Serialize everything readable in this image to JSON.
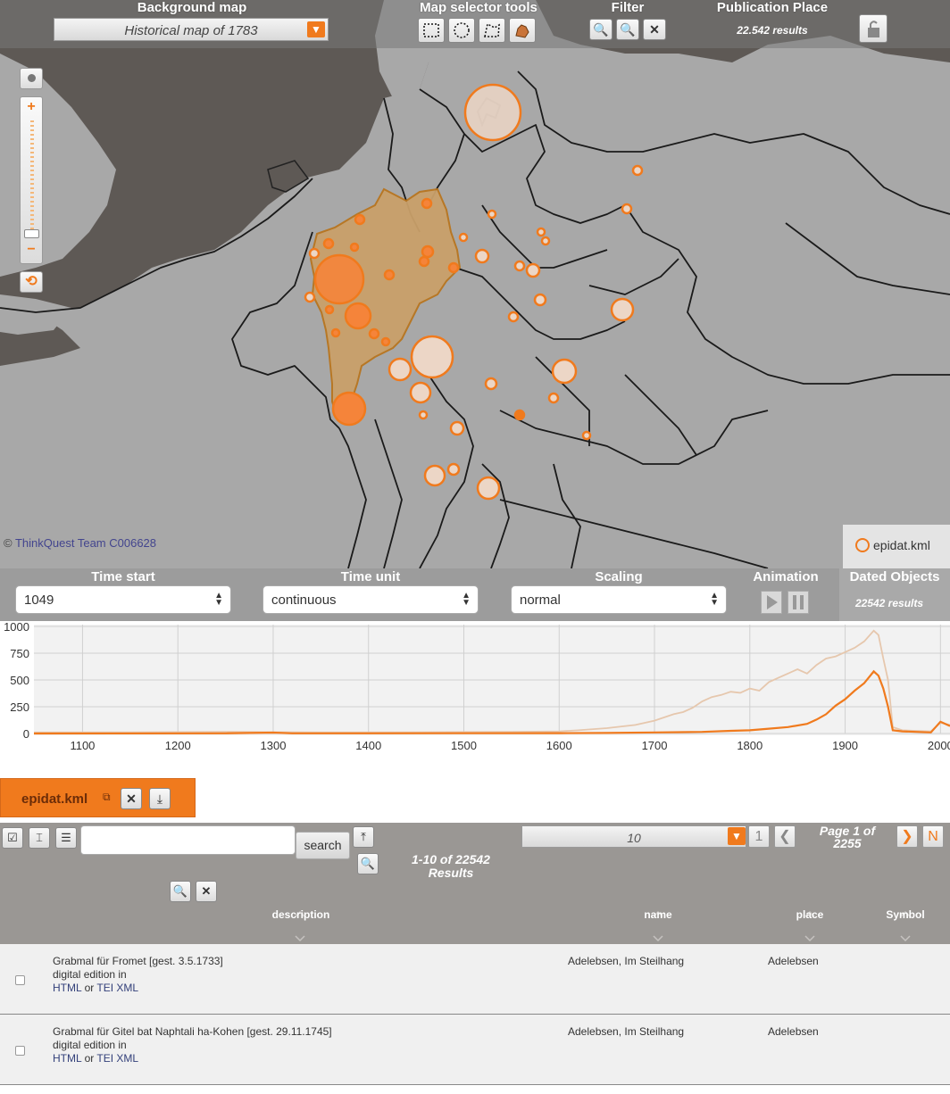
{
  "toolbar": {
    "background_map_title": "Background map",
    "background_map_value": "Historical map of 1783",
    "selector_tools_title": "Map selector tools",
    "filter_title": "Filter",
    "publication_place_title": "Publication Place",
    "publication_place_results": "22.542 results"
  },
  "map": {
    "copyright_symbol": "©",
    "copyright_text": "ThinkQuest Team C006628",
    "legend_dataset": "epidat.kml",
    "zoom_in": "+",
    "zoom_out": "−",
    "zoom_level_fraction": 0.18
  },
  "time_controls": {
    "time_start_label": "Time start",
    "time_start_value": "1049",
    "time_unit_label": "Time unit",
    "time_unit_value": "continuous",
    "scaling_label": "Scaling",
    "scaling_value": "normal",
    "animation_label": "Animation",
    "dated_objects_label": "Dated Objects",
    "dated_objects_results": "22542 results"
  },
  "chart_data": {
    "type": "line",
    "x_ticks": [
      "1100",
      "1200",
      "1300",
      "1400",
      "1500",
      "1600",
      "1700",
      "1800",
      "1900",
      "2000"
    ],
    "y_ticks": [
      "0",
      "250",
      "500",
      "750",
      "1000"
    ],
    "xlim": [
      1049,
      2010
    ],
    "ylim": [
      0,
      1000
    ],
    "grid": true,
    "series": [
      {
        "color": "#e6c7ad",
        "x": [
          1049,
          1150,
          1250,
          1350,
          1450,
          1550,
          1600,
          1620,
          1650,
          1680,
          1700,
          1710,
          1720,
          1730,
          1740,
          1750,
          1760,
          1770,
          1780,
          1790,
          1800,
          1810,
          1820,
          1830,
          1840,
          1850,
          1860,
          1870,
          1880,
          1890,
          1900,
          1910,
          1920,
          1930,
          1935,
          1940,
          1945,
          1950,
          1960,
          1990,
          2000,
          2010
        ],
        "y": [
          10,
          12,
          15,
          10,
          12,
          15,
          20,
          30,
          50,
          80,
          120,
          150,
          180,
          200,
          240,
          300,
          340,
          360,
          390,
          380,
          420,
          400,
          480,
          520,
          560,
          600,
          560,
          640,
          700,
          720,
          760,
          800,
          860,
          960,
          920,
          700,
          500,
          60,
          30,
          20,
          100,
          80
        ]
      },
      {
        "color": "#f07a1d",
        "x": [
          1049,
          1250,
          1300,
          1320,
          1400,
          1600,
          1650,
          1700,
          1750,
          1780,
          1800,
          1820,
          1840,
          1860,
          1870,
          1880,
          1890,
          1900,
          1910,
          1920,
          1930,
          1935,
          1940,
          1945,
          1950,
          1960,
          1990,
          2000,
          2010
        ],
        "y": [
          0,
          2,
          8,
          2,
          2,
          3,
          5,
          10,
          15,
          25,
          30,
          45,
          60,
          90,
          130,
          180,
          260,
          320,
          400,
          470,
          580,
          540,
          420,
          250,
          30,
          20,
          10,
          110,
          70
        ]
      }
    ]
  },
  "dataset_tab": {
    "name": "epidat.kml"
  },
  "table_controls": {
    "search_placeholder": "",
    "search_button": "search",
    "range_line1": "1-10 of 22542",
    "range_line2": "Results",
    "per_page_value": "10",
    "first_page_label": "1",
    "page_line1": "Page 1 of",
    "page_line2": "2255",
    "last_page_label": "N",
    "columns": {
      "description": "description",
      "name": "name",
      "place": "place",
      "symbol": "Symbol"
    }
  },
  "rows": [
    {
      "title": "Grabmal für Fromet [gest. 3.5.1733]",
      "edition": "digital edition in",
      "html_link": "HTML",
      "or": "or",
      "tei_link": "TEI XML",
      "name": "Adelebsen, Im Steilhang",
      "place": "Adelebsen"
    },
    {
      "title": "Grabmal für Gitel bat Naphtali ha-Kohen [gest. 29.11.1745]",
      "edition": "digital edition in",
      "html_link": "HTML",
      "or": "or",
      "tei_link": "TEI XML",
      "name": "Adelebsen, Im Steilhang",
      "place": "Adelebsen"
    }
  ]
}
